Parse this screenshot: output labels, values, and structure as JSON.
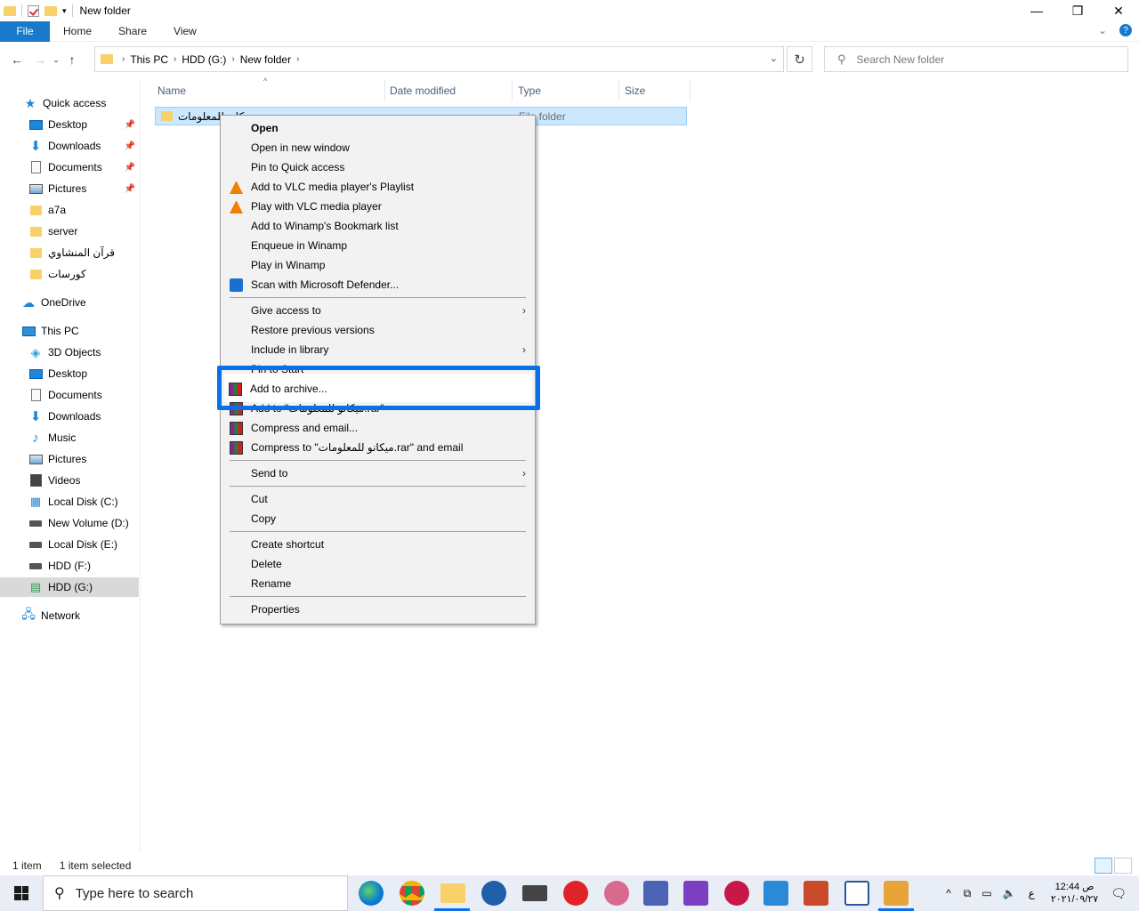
{
  "window": {
    "title": "New folder",
    "controls": {
      "minimize": "—",
      "maximize": "❐",
      "close": "✕"
    }
  },
  "ribbon": {
    "tabs": [
      "File",
      "Home",
      "Share",
      "View"
    ]
  },
  "address": {
    "crumbs": [
      "This PC",
      "HDD (G:)",
      "New folder"
    ],
    "search_placeholder": "Search New folder"
  },
  "nav": {
    "items": [
      {
        "label": "Quick access",
        "icon": "star-icon"
      },
      {
        "label": "Desktop",
        "icon": "desktop-icon",
        "pinned": true
      },
      {
        "label": "Downloads",
        "icon": "download-icon",
        "pinned": true
      },
      {
        "label": "Documents",
        "icon": "document-icon",
        "pinned": true
      },
      {
        "label": "Pictures",
        "icon": "pictures-icon",
        "pinned": true
      },
      {
        "label": "a7a",
        "icon": "folder-icon"
      },
      {
        "label": "server",
        "icon": "folder-icon"
      },
      {
        "label": "قرآن المنشاوي",
        "icon": "folder-icon"
      },
      {
        "label": "كورسات",
        "icon": "folder-icon"
      },
      {
        "label": "OneDrive",
        "icon": "cloud-icon"
      },
      {
        "label": "This PC",
        "icon": "computer-icon"
      },
      {
        "label": "3D Objects",
        "icon": "cube-icon"
      },
      {
        "label": "Desktop",
        "icon": "desktop-icon"
      },
      {
        "label": "Documents",
        "icon": "document-icon"
      },
      {
        "label": "Downloads",
        "icon": "download-icon"
      },
      {
        "label": "Music",
        "icon": "music-icon"
      },
      {
        "label": "Pictures",
        "icon": "pictures-icon"
      },
      {
        "label": "Videos",
        "icon": "video-icon"
      },
      {
        "label": "Local Disk (C:)",
        "icon": "drive-icon"
      },
      {
        "label": "New Volume (D:)",
        "icon": "drive-icon"
      },
      {
        "label": "Local Disk (E:)",
        "icon": "drive-icon"
      },
      {
        "label": "HDD (F:)",
        "icon": "drive-icon"
      },
      {
        "label": "HDD (G:)",
        "icon": "drive-icon",
        "selected": true
      },
      {
        "label": "Network",
        "icon": "network-icon"
      }
    ]
  },
  "columns": [
    "Name",
    "Date modified",
    "Type",
    "Size"
  ],
  "files": [
    {
      "name": "ميكانو للمعلومات",
      "date": "",
      "type": "File folder"
    }
  ],
  "context_menu": {
    "items": [
      "Open",
      "Open in new window",
      "Pin to Quick access",
      "Add to VLC media player's Playlist",
      "Play with VLC media player",
      "Add to Winamp's Bookmark list",
      "Enqueue in Winamp",
      "Play in Winamp",
      "Scan with Microsoft Defender...",
      "Give access to",
      "Restore previous versions",
      "Include in library",
      "Pin to Start",
      "Add to archive...",
      "Add to \"ميكانو للمعلومات.rar\"",
      "Compress and email...",
      "Compress to \"ميكانو للمعلومات.rar\" and email",
      "Send to",
      "Cut",
      "Copy",
      "Create shortcut",
      "Delete",
      "Rename",
      "Properties"
    ]
  },
  "status": {
    "count": "1 item",
    "selected": "1 item selected"
  },
  "taskbar": {
    "search_placeholder": "Type here to search",
    "time": "12:44 ص",
    "date": "٢٠٢١/٠٩/٢٧",
    "lang": "ع"
  },
  "colors": {
    "accent": "#1979ca",
    "highlight_box": "#0a6fe8",
    "selection": "#cce8ff"
  }
}
